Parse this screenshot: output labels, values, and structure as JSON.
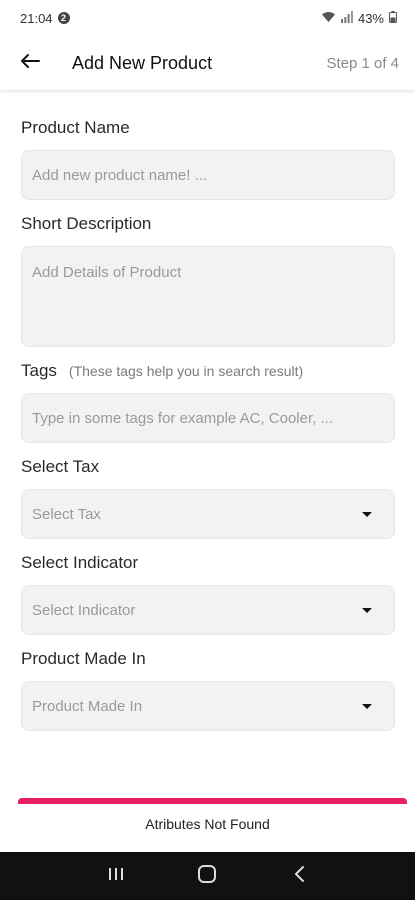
{
  "status_bar": {
    "time": "21:04",
    "notification_badge": "2",
    "battery": "43%"
  },
  "appbar": {
    "title": "Add New Product",
    "step": "Step 1 of 4"
  },
  "form": {
    "product_name": {
      "label": "Product Name",
      "placeholder": "Add new product name! ..."
    },
    "short_description": {
      "label": "Short Description",
      "placeholder": "Add Details of Product"
    },
    "tags": {
      "label": "Tags",
      "hint": "(These tags help you in search result)",
      "placeholder": "Type in some tags for example AC, Cooler, ..."
    },
    "select_tax": {
      "label": "Select Tax",
      "placeholder": "Select Tax"
    },
    "select_indicator": {
      "label": "Select Indicator",
      "placeholder": "Select Indicator"
    },
    "product_made_in": {
      "label": "Product Made In",
      "placeholder": "Product Made In"
    }
  },
  "footer": {
    "message": "Atributes Not Found",
    "accent_color": "#e91e63"
  },
  "nav_bar": {
    "icons": [
      "recent-apps-icon",
      "home-icon",
      "back-icon"
    ]
  }
}
